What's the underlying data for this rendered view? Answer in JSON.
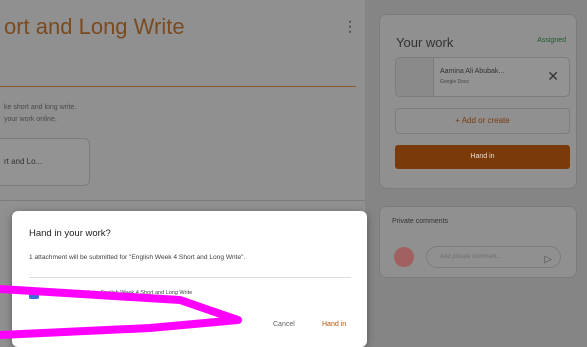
{
  "main": {
    "title": "ort and Long Write",
    "more_icon": "more-vert-icon",
    "description_lines": [
      "ke short and long write.",
      "your work online."
    ],
    "attachment_title": "rt and Lo..."
  },
  "your_work": {
    "title": "Your work",
    "status": "Assigned",
    "file_name": "Aamina Ali Abubak...",
    "file_type": "Google Docs",
    "add_or_create": "+ Add or create",
    "hand_in": "Hand in"
  },
  "private_comments": {
    "title": "Private comments",
    "placeholder": "Add private comment...",
    "send_icon": "send-icon"
  },
  "dialog": {
    "title": "Hand in your work?",
    "message": "1 attachment will be submitted for \"English Week 4 Short and Long Write\".",
    "file_name": "Aamina Ali Abubakar - English Week 4 Short and Long Write",
    "cancel": "Cancel",
    "hand_in": "Hand in"
  },
  "colors": {
    "accent": "#b45309",
    "scribble": "#ff00ff"
  }
}
